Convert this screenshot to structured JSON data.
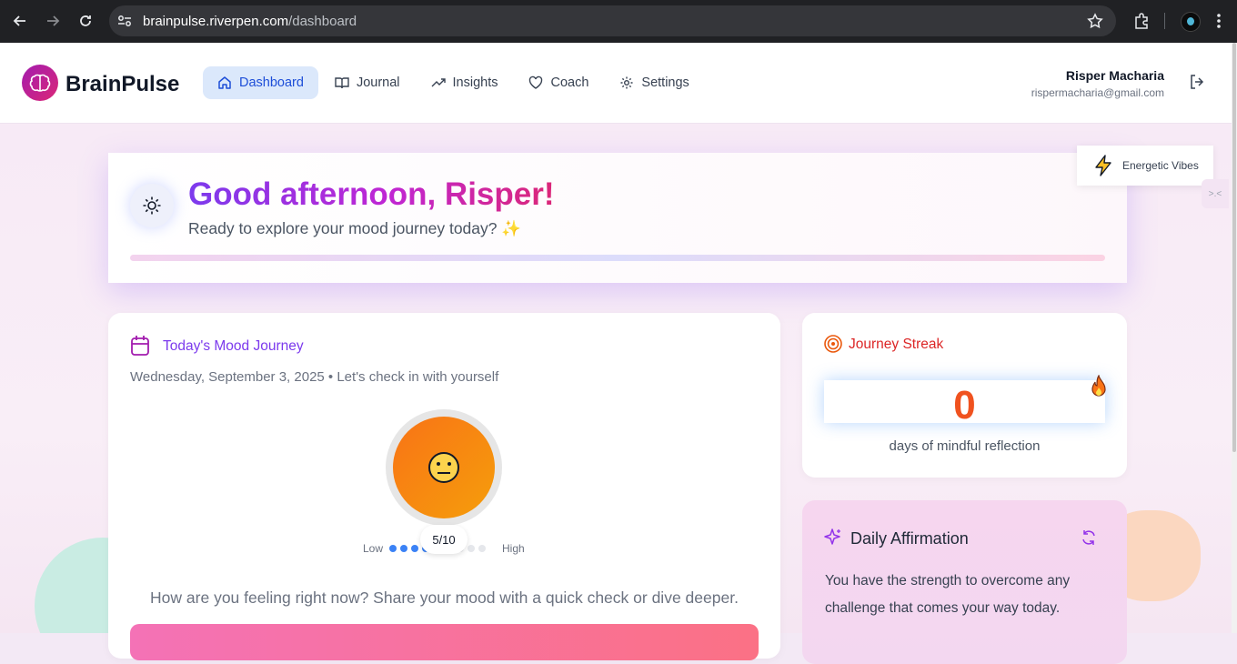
{
  "browser": {
    "url_host": "brainpulse.riverpen.com",
    "url_path": "/dashboard"
  },
  "app": {
    "name": "BrainPulse",
    "nav": [
      {
        "label": "Dashboard",
        "icon": "home-icon",
        "active": true
      },
      {
        "label": "Journal",
        "icon": "book-icon",
        "active": false
      },
      {
        "label": "Insights",
        "icon": "trending-up-icon",
        "active": false
      },
      {
        "label": "Coach",
        "icon": "heart-icon",
        "active": false
      },
      {
        "label": "Settings",
        "icon": "gear-icon",
        "active": false
      }
    ],
    "user": {
      "name": "Risper Macharia",
      "email": "rispermacharia@gmail.com"
    }
  },
  "greeting": {
    "title": "Good afternoon, Risper!",
    "subtitle": "Ready to explore your mood journey today? ✨"
  },
  "vibes": {
    "label": "Energetic Vibes"
  },
  "side_tab": {
    "label": ">.<"
  },
  "mood": {
    "title": "Today's Mood Journey",
    "date_line": "Wednesday, September 3, 2025 • Let's check in with yourself",
    "score": "5/10",
    "score_value": 5,
    "score_max": 10,
    "scale_low": "Low",
    "scale_high": "High",
    "question": "How are you feeling right now? Share your mood with a quick check or dive deeper."
  },
  "streak": {
    "title": "Journey Streak",
    "count": "0",
    "subtitle": "days of mindful reflection"
  },
  "affirmation": {
    "title": "Daily Affirmation",
    "text": "You have the strength to overcome any challenge that comes your way today."
  },
  "colors": {
    "accent": "#7c3aed",
    "active_nav_bg": "#dbe8fb",
    "streak": "#f0521f",
    "mood_orb": "#f97316"
  }
}
